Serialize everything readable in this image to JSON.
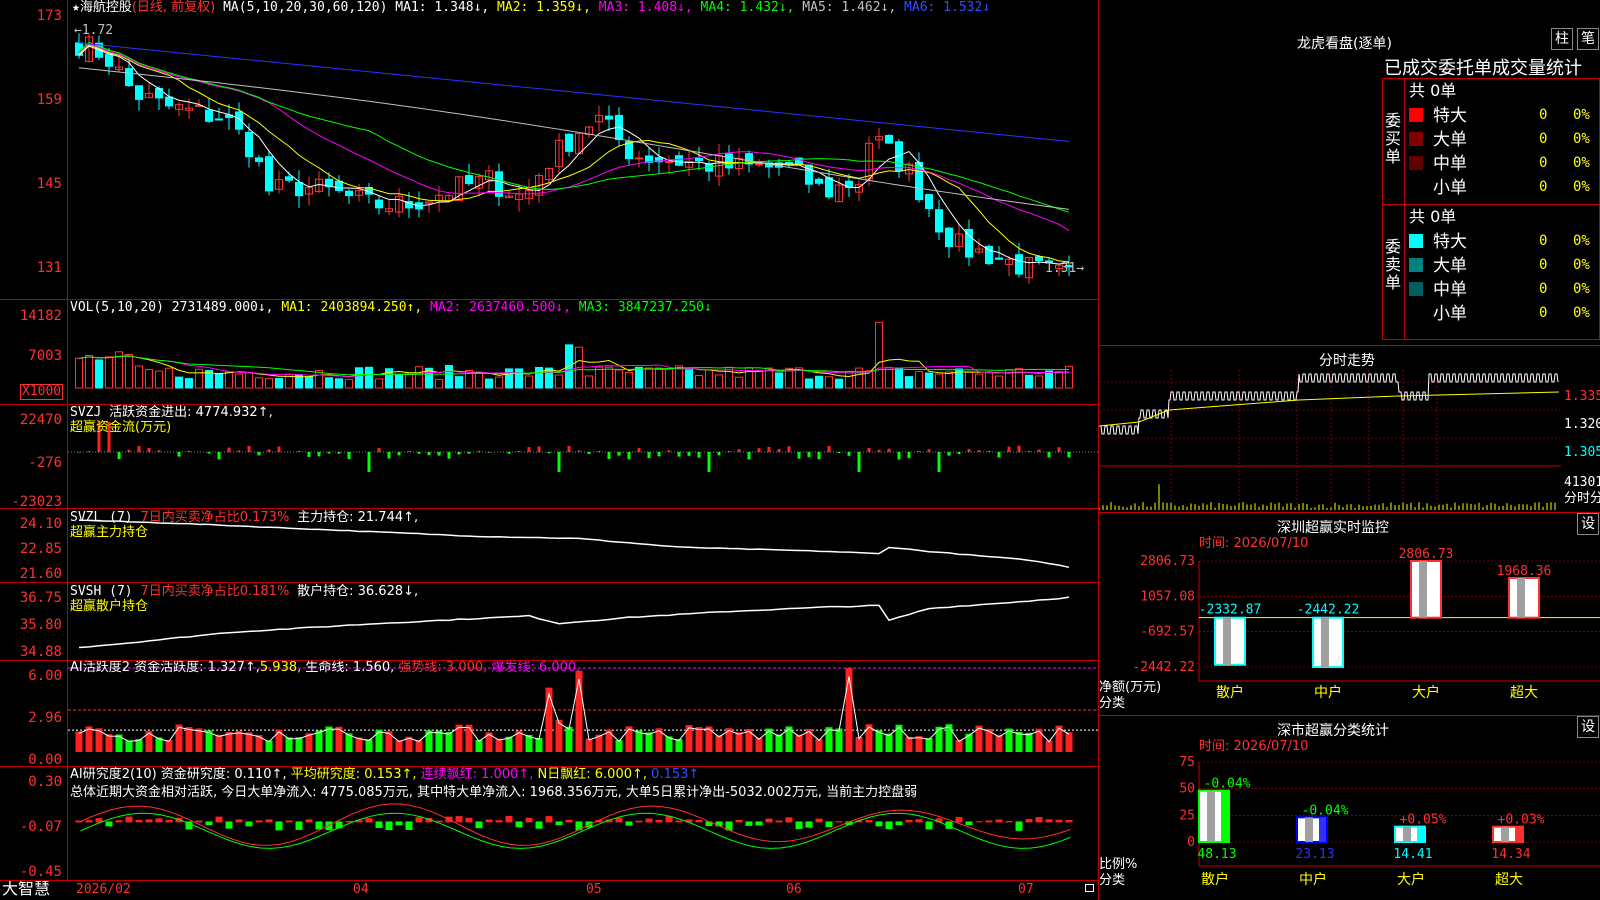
{
  "colors": {
    "up": "#ff3333",
    "down": "#00ffff",
    "ma1": "#ffffff",
    "ma2": "#ffff00",
    "ma3": "#ff00ff",
    "ma4": "#00ff00",
    "ma5": "#c0c0c0",
    "ma6": "#3030ff",
    "grid": "#c00000"
  },
  "main": {
    "star": "★",
    "stock": "海航控股",
    "mode": "(日线, 前复权)",
    "ma_label": "MA(5,10,20,30,60,120)",
    "ma1": "MA1: 1.348↓,",
    "ma2": "MA2: 1.359↓,",
    "ma3": "MA3: 1.408↓,",
    "ma4": "MA4: 1.432↓,",
    "ma5": "MA5: 1.462↓,",
    "ma6": "MA6: 1.532↓",
    "high_marker": "←1.72",
    "low_marker": "1.31→",
    "y_ticks": [
      "173",
      "159",
      "145",
      "131"
    ]
  },
  "vol": {
    "label": "VOL(5,10,20)",
    "value": "2731489.000↓,",
    "ma1": "MA1: 2403894.250↑,",
    "ma2": "MA2: 2637460.500↓,",
    "ma3": "MA3: 3847237.250↓",
    "y_ticks": [
      "14182",
      "7003"
    ],
    "unit": "X1000"
  },
  "svzj": {
    "label": "SVZJ",
    "name": "活跃资金进出: 4774.932↑,",
    "subtitle": "超赢资金流(万元)",
    "y_ticks": [
      "22470",
      "-276",
      "-23023"
    ]
  },
  "svzl": {
    "label": "SVZL (7)",
    "ratio": "7日内买卖净占比0.173%",
    "hold": "主力持仓: 21.744↑,",
    "subtitle": "超赢主力持仓",
    "y_ticks": [
      "24.10",
      "22.85",
      "21.60"
    ]
  },
  "svsh": {
    "label": "SVSH (7)",
    "ratio": "7日内买卖净占比0.181%",
    "hold": "散户持仓: 36.628↓,",
    "subtitle": "超赢散户持仓",
    "y_ticks": [
      "36.75",
      "35.80",
      "34.88"
    ]
  },
  "ai1": {
    "label": "AI活跃度2",
    "a": "资金活跃度: 1.327↑,",
    "b": "5.938,",
    "c": "生命线: 1.560,",
    "d": "强势线: 3.000,",
    "e": "爆发线: 6.000,",
    "y_ticks": [
      "6.00",
      "2.96",
      "0.00"
    ]
  },
  "ai2": {
    "label": "AI研究度2(10)",
    "a": "资金研究度: 0.110↑,",
    "b": "平均研究度: 0.153↑,",
    "c": "连续飘红: 1.000↑,",
    "d": "N日飘红: 6.000↑,",
    "e": "0.153↑",
    "summary": "总体近期大资金相对活跃, 今日大单净流入: 4775.085万元, 其中特大单净流入: 1968.356万元, 大单5日累计净出-5032.002万元, 当前主力控盘弱",
    "y_ticks": [
      "0.30",
      "-0.07",
      "-0.45"
    ]
  },
  "xaxis": {
    "brand": "大智慧",
    "labels": [
      "2026/02",
      "04",
      "05",
      "06",
      "07"
    ]
  },
  "side": {
    "longhu": {
      "title": "龙虎看盘(逐单)",
      "btn1": "柱",
      "btn2": "笔",
      "subtitle": "已成交委托单成交量统计"
    },
    "buy": {
      "group": "委买单",
      "total": "共 0单",
      "rows": [
        {
          "name": "特大",
          "value": "0",
          "pct": "0%",
          "color": "#ff0000"
        },
        {
          "name": "大单",
          "value": "0",
          "pct": "0%",
          "color": "#800000"
        },
        {
          "name": "中单",
          "value": "0",
          "pct": "0%",
          "color": "#600000"
        },
        {
          "name": "小单",
          "value": "0",
          "pct": "0%",
          "color": "#000000"
        }
      ]
    },
    "sell": {
      "group": "委卖单",
      "total": "共 0单",
      "rows": [
        {
          "name": "特大",
          "value": "0",
          "pct": "0%",
          "color": "#00ffff"
        },
        {
          "name": "大单",
          "value": "0",
          "pct": "0%",
          "color": "#008080"
        },
        {
          "name": "中单",
          "value": "0",
          "pct": "0%",
          "color": "#006060"
        },
        {
          "name": "小单",
          "value": "0",
          "pct": "0%",
          "color": "#000000"
        }
      ]
    },
    "intraday": {
      "title": "分时走势",
      "ticks": [
        "1.335",
        "1.320",
        "1.305"
      ],
      "vol": "41301",
      "vol_label": "分时分"
    },
    "monitor": {
      "title": "深圳超赢实时监控",
      "btn": "设",
      "time": "时间: 2026/07/10",
      "y_ticks": [
        "2806.73",
        "1057.08",
        "-692.57",
        "-2442.22"
      ],
      "ylabel": "净额(万元)",
      "xlabel": "分类",
      "categories": [
        "散户",
        "中户",
        "大户",
        "超大"
      ],
      "values": [
        -2332.87,
        -2442.22,
        2806.73,
        1968.36
      ],
      "value_labels": [
        "-2332.87",
        "-2442.22",
        "2806.73",
        "1968.36"
      ]
    },
    "classify": {
      "title": "深市超赢分类统计",
      "btn": "设",
      "time": "时间: 2026/07/10",
      "y_ticks": [
        "75",
        "50",
        "25",
        "0"
      ],
      "ylabel": "比例%",
      "xlabel": "分类",
      "categories": [
        "散户",
        "中户",
        "大户",
        "超大"
      ],
      "values": [
        48.13,
        23.13,
        14.41,
        14.34
      ],
      "value_labels": [
        "48.13",
        "23.13",
        "14.41",
        "14.34"
      ],
      "changes": [
        "-0.04%",
        "-0.04%",
        "+0.05%",
        "+0.03%"
      ]
    }
  }
}
